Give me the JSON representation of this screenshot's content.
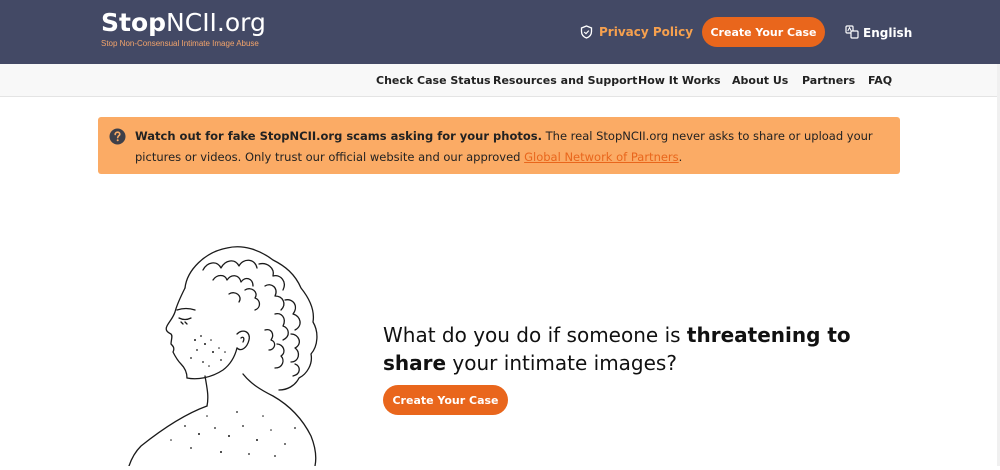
{
  "header": {
    "logo_bold": "Stop",
    "logo_rest": "NCII.org",
    "tagline": "Stop Non-Consensual Intimate Image Abuse",
    "privacy_label": "Privacy Policy",
    "cta_label": "Create Your Case",
    "language_label": "English"
  },
  "nav": {
    "items": [
      {
        "label": "Check Case Status"
      },
      {
        "label": "Resources and Support"
      },
      {
        "label": "How It Works"
      },
      {
        "label": "About Us"
      },
      {
        "label": "Partners"
      },
      {
        "label": "FAQ"
      }
    ]
  },
  "alert": {
    "bold_text": "Watch out for fake StopNCII.org scams asking for your photos.",
    "body_text": " The real StopNCII.org never asks to share or upload your pictures or videos. Only trust our official website and our approved ",
    "link_text": "Global Network of Partners",
    "end_text": "."
  },
  "hero": {
    "part1": "What do you do if someone is ",
    "bold1": "threatening to share",
    "part2": " your intimate images?",
    "cta_label": "Create Your Case"
  },
  "colors": {
    "header_bg": "#434965",
    "accent": "#e9661c",
    "alert_bg": "#fbab65",
    "privacy_link": "#f6a04e"
  },
  "icons": {
    "privacy": "shield-icon",
    "language": "translate-icon",
    "alert": "question-icon"
  }
}
